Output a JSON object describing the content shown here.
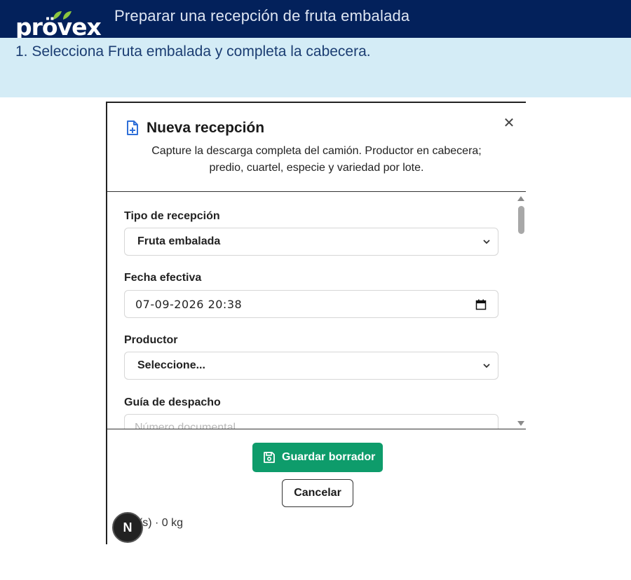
{
  "header": {
    "logo_text": "prövex",
    "title": "Preparar una recepción de fruta embalada",
    "brand_color": "#03215b",
    "leaf_color": "#8cc63f"
  },
  "instruction": {
    "step_text": "1. Selecciona Fruta embalada y completa la cabecera."
  },
  "modal": {
    "title": "Nueva recepción",
    "subtitle_line1": "Capture la descarga completa del camión. Productor en cabecera;",
    "subtitle_line2": "predio, cuartel, especie y variedad por lote.",
    "close_glyph": "✕",
    "fields": {
      "tipo": {
        "label": "Tipo de recepción",
        "value": "Fruta embalada"
      },
      "fecha": {
        "label": "Fecha efectiva",
        "value": "07-09-2026  20:38"
      },
      "productor": {
        "label": "Productor",
        "value": "Seleccione..."
      },
      "guia": {
        "label": "Guía de despacho",
        "placeholder": "Número documental"
      }
    },
    "save_label": "Guardar borrador",
    "cancel_label": "Cancelar",
    "summary_text": "e(s) · 0 kg",
    "avatar_letter": "N",
    "accent_color": "#0e9c6b"
  }
}
